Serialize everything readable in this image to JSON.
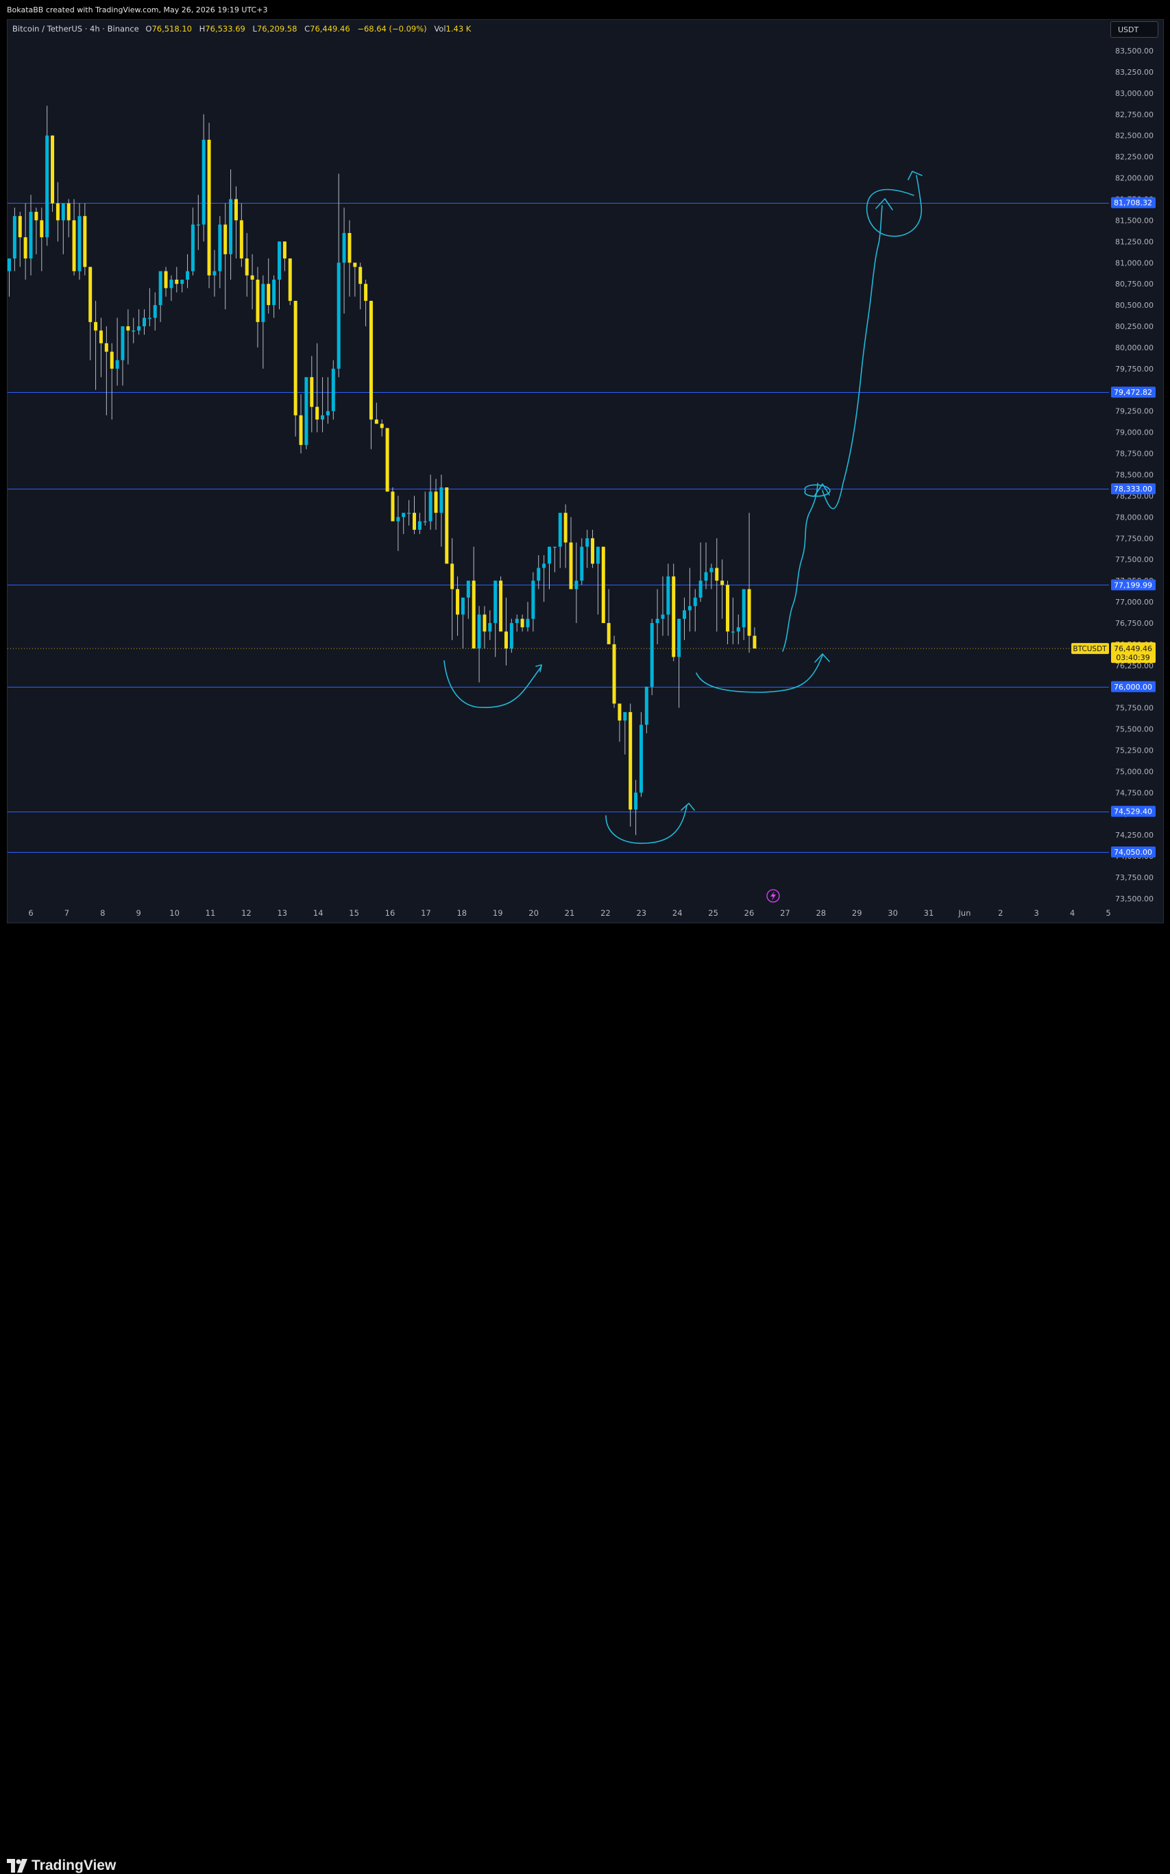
{
  "header": {
    "credit": "BokataBB created with TradingView.com, May 26, 2026 19:19 UTC+3"
  },
  "legend": {
    "symbol": "Bitcoin / TetherUS · 4h · Binance",
    "open_label": "O",
    "open": "76,518.10",
    "high_label": "H",
    "high": "76,533.69",
    "low_label": "L",
    "low": "76,209.58",
    "close_label": "C",
    "close": "76,449.46",
    "change": "−68.64 (−0.09%)",
    "vol_label": "Vol",
    "vol": "1.43 K"
  },
  "currency": "USDT",
  "footer": {
    "brand": "TradingView"
  },
  "colors": {
    "background": "#131722",
    "bull": "#00b4d8",
    "bear": "#f7e017",
    "hline": "#2962ff",
    "drawing": "#22b8d6",
    "price_tag": "#f7d618"
  },
  "chart_data": {
    "type": "candlestick",
    "symbol": "BTCUSDT",
    "timeframe": "4h",
    "ylim": [
      73400,
      83750
    ],
    "y_ticks": [
      "83,500.00",
      "83,250.00",
      "83,000.00",
      "82,750.00",
      "82,500.00",
      "82,250.00",
      "82,000.00",
      "81,750.00",
      "81,500.00",
      "81,250.00",
      "81,000.00",
      "80,750.00",
      "80,500.00",
      "80,250.00",
      "80,000.00",
      "79,750.00",
      "79,500.00",
      "79,250.00",
      "79,000.00",
      "78,750.00",
      "78,500.00",
      "78,250.00",
      "78,000.00",
      "77,750.00",
      "77,500.00",
      "77,250.00",
      "77,000.00",
      "76,750.00",
      "76,500.00",
      "76,250.00",
      "76,000.00",
      "75,750.00",
      "75,500.00",
      "75,250.00",
      "75,000.00",
      "74,750.00",
      "74,500.00",
      "74,250.00",
      "74,000.00",
      "73,750.00",
      "73,500.00"
    ],
    "x_ticks": [
      "6",
      "7",
      "8",
      "9",
      "10",
      "11",
      "12",
      "13",
      "14",
      "15",
      "16",
      "17",
      "18",
      "19",
      "20",
      "21",
      "22",
      "23",
      "24",
      "25",
      "26",
      "27",
      "28",
      "29",
      "30",
      "31",
      "Jun",
      "2",
      "3",
      "4",
      "5"
    ],
    "horizontal_levels": [
      {
        "value": 81708.32,
        "label": "81,708.32"
      },
      {
        "value": 79472.82,
        "label": "79,472.82"
      },
      {
        "value": 78333.0,
        "label": "78,333.00"
      },
      {
        "value": 77199.99,
        "label": "77,199.99"
      },
      {
        "value": 76000.0,
        "label": "76,000.00"
      },
      {
        "value": 74529.4,
        "label": "74,529.40"
      },
      {
        "value": 74050.0,
        "label": "74,050.00"
      }
    ],
    "last_price": {
      "value": 76449.46,
      "label": "76,449.46",
      "countdown": "03:40:39",
      "symbol": "BTCUSDT"
    },
    "candles": [
      [
        80900,
        81050,
        80600,
        81050
      ],
      [
        81050,
        81650,
        80900,
        81550
      ],
      [
        81550,
        81600,
        80950,
        81300
      ],
      [
        81300,
        81700,
        80800,
        81050
      ],
      [
        81050,
        81800,
        80850,
        81600
      ],
      [
        81600,
        81650,
        81100,
        81500
      ],
      [
        81500,
        81650,
        80900,
        81300
      ],
      [
        81300,
        82850,
        81200,
        82500
      ],
      [
        82500,
        82500,
        81600,
        81700
      ],
      [
        81700,
        81950,
        81250,
        81500
      ],
      [
        81500,
        81700,
        81100,
        81700
      ],
      [
        81700,
        81750,
        81300,
        81500
      ],
      [
        81500,
        81750,
        80850,
        80900
      ],
      [
        80900,
        81700,
        80800,
        81550
      ],
      [
        81550,
        81700,
        80850,
        80950
      ],
      [
        80950,
        80950,
        79850,
        80300
      ],
      [
        80300,
        80550,
        79500,
        80200
      ],
      [
        80200,
        80350,
        79650,
        80050
      ],
      [
        80050,
        80250,
        79200,
        79950
      ],
      [
        79950,
        80050,
        79150,
        79750
      ],
      [
        79750,
        80350,
        79550,
        79850
      ],
      [
        79850,
        80250,
        79550,
        80250
      ],
      [
        80250,
        80450,
        79800,
        80200
      ],
      [
        80200,
        80350,
        80050,
        80200
      ],
      [
        80200,
        80450,
        80150,
        80250
      ],
      [
        80250,
        80450,
        80150,
        80350
      ],
      [
        80350,
        80700,
        80250,
        80350
      ],
      [
        80350,
        80650,
        80200,
        80500
      ],
      [
        80500,
        80900,
        80300,
        80900
      ],
      [
        80900,
        80950,
        80600,
        80700
      ],
      [
        80700,
        80850,
        80550,
        80800
      ],
      [
        80800,
        80950,
        80650,
        80750
      ],
      [
        80750,
        80800,
        80650,
        80800
      ],
      [
        80800,
        81100,
        80700,
        80900
      ],
      [
        80900,
        81650,
        80850,
        81450
      ],
      [
        81450,
        81800,
        81150,
        81450
      ],
      [
        81450,
        82750,
        81250,
        82450
      ],
      [
        82450,
        82650,
        80700,
        80850
      ],
      [
        80850,
        81150,
        80600,
        80900
      ],
      [
        80900,
        81550,
        80700,
        81450
      ],
      [
        81450,
        81700,
        80450,
        81100
      ],
      [
        81100,
        82100,
        80800,
        81750
      ],
      [
        81750,
        81900,
        81050,
        81500
      ],
      [
        81500,
        81700,
        80950,
        81050
      ],
      [
        81050,
        81350,
        80600,
        80850
      ],
      [
        80850,
        81100,
        80450,
        80800
      ],
      [
        80800,
        80950,
        80000,
        80300
      ],
      [
        80300,
        80850,
        79750,
        80750
      ],
      [
        80750,
        81050,
        80400,
        80500
      ],
      [
        80500,
        80850,
        80350,
        80800
      ],
      [
        80800,
        81250,
        80450,
        81250
      ],
      [
        81250,
        81250,
        80900,
        81050
      ],
      [
        81050,
        81050,
        80500,
        80550
      ],
      [
        80550,
        80550,
        78950,
        79200
      ],
      [
        79200,
        79450,
        78750,
        78850
      ],
      [
        78850,
        79250,
        78800,
        79650
      ],
      [
        79650,
        79900,
        79000,
        79300
      ],
      [
        79300,
        80050,
        79000,
        79150
      ],
      [
        79150,
        79650,
        79000,
        79200
      ],
      [
        79200,
        79650,
        79100,
        79250
      ],
      [
        79250,
        79850,
        79150,
        79750
      ],
      [
        79750,
        82050,
        79650,
        81000
      ],
      [
        81000,
        81650,
        80400,
        81350
      ],
      [
        81350,
        81500,
        80600,
        81000
      ],
      [
        81000,
        81000,
        80600,
        80950
      ],
      [
        80950,
        81000,
        80450,
        80750
      ],
      [
        80750,
        80800,
        80250,
        80550
      ],
      [
        80550,
        80550,
        78800,
        79150
      ],
      [
        79150,
        79350,
        79100,
        79100
      ],
      [
        79100,
        79150,
        78950,
        79050
      ],
      [
        79050,
        79050,
        78350,
        78300
      ],
      [
        78300,
        78350,
        78100,
        77950
      ],
      [
        77950,
        78250,
        77600,
        78000
      ],
      [
        78000,
        78050,
        77800,
        78050
      ],
      [
        78050,
        78200,
        77900,
        78050
      ],
      [
        78050,
        78250,
        77800,
        77850
      ],
      [
        77850,
        78050,
        77800,
        77950
      ],
      [
        77950,
        78300,
        77900,
        77950
      ],
      [
        77950,
        78500,
        77850,
        78300
      ],
      [
        78300,
        78450,
        77850,
        78050
      ],
      [
        78050,
        78500,
        77650,
        78350
      ],
      [
        78350,
        78350,
        77550,
        77450
      ],
      [
        77450,
        77750,
        76550,
        77150
      ],
      [
        77150,
        77300,
        76600,
        76850
      ],
      [
        76850,
        77050,
        76450,
        77050
      ],
      [
        77050,
        77150,
        76800,
        77250
      ],
      [
        77250,
        77650,
        76450,
        76450
      ],
      [
        76450,
        76950,
        76050,
        76850
      ],
      [
        76850,
        76950,
        76450,
        76650
      ],
      [
        76650,
        76900,
        76550,
        76750
      ],
      [
        76750,
        77250,
        76350,
        77250
      ],
      [
        77250,
        77300,
        76700,
        76650
      ],
      [
        76650,
        77050,
        76250,
        76450
      ],
      [
        76450,
        76800,
        76400,
        76750
      ],
      [
        76750,
        76850,
        76650,
        76800
      ],
      [
        76800,
        76850,
        76650,
        76700
      ],
      [
        76700,
        77000,
        76650,
        76800
      ],
      [
        76800,
        77350,
        76650,
        77250
      ],
      [
        77250,
        77550,
        77150,
        77400
      ],
      [
        77400,
        77550,
        77000,
        77450
      ],
      [
        77450,
        77650,
        77150,
        77650
      ],
      [
        77650,
        77650,
        77350,
        77650
      ],
      [
        77650,
        78050,
        77400,
        78050
      ],
      [
        78050,
        78150,
        77400,
        77700
      ],
      [
        77700,
        78000,
        77150,
        77150
      ],
      [
        77150,
        77700,
        76750,
        77250
      ],
      [
        77250,
        77750,
        77200,
        77650
      ],
      [
        77650,
        77850,
        77400,
        77750
      ],
      [
        77750,
        77850,
        77400,
        77450
      ],
      [
        77450,
        77650,
        76850,
        77650
      ],
      [
        77650,
        77650,
        76850,
        76750
      ],
      [
        76750,
        77150,
        76550,
        76500
      ],
      [
        76500,
        76600,
        75750,
        75800
      ],
      [
        75800,
        75800,
        75350,
        75600
      ],
      [
        75600,
        75650,
        75200,
        75700
      ],
      [
        75700,
        75800,
        74350,
        74550
      ],
      [
        74550,
        74900,
        74250,
        74750
      ],
      [
        74750,
        75700,
        74700,
        75550
      ],
      [
        75550,
        76000,
        75450,
        76000
      ],
      [
        76000,
        76800,
        75900,
        76750
      ],
      [
        76750,
        77150,
        76500,
        76800
      ],
      [
        76800,
        77300,
        76600,
        76850
      ],
      [
        76850,
        77450,
        76600,
        77300
      ],
      [
        77300,
        77450,
        76300,
        76350
      ],
      [
        76350,
        76800,
        75750,
        76800
      ],
      [
        76800,
        77050,
        76550,
        76900
      ],
      [
        76900,
        77400,
        76650,
        76950
      ],
      [
        76950,
        77150,
        76650,
        77050
      ],
      [
        77050,
        77700,
        77000,
        77250
      ],
      [
        77250,
        77700,
        77150,
        77350
      ],
      [
        77350,
        77450,
        77150,
        77400
      ],
      [
        77400,
        77750,
        76650,
        77250
      ],
      [
        77250,
        77500,
        76800,
        77200
      ],
      [
        77200,
        77250,
        76500,
        76650
      ],
      [
        76650,
        77050,
        76500,
        76650
      ],
      [
        76650,
        76850,
        76500,
        76700
      ],
      [
        76700,
        77050,
        76550,
        77150
      ],
      [
        77150,
        78050,
        76400,
        76600
      ],
      [
        76600,
        76700,
        76450,
        76450
      ]
    ]
  }
}
